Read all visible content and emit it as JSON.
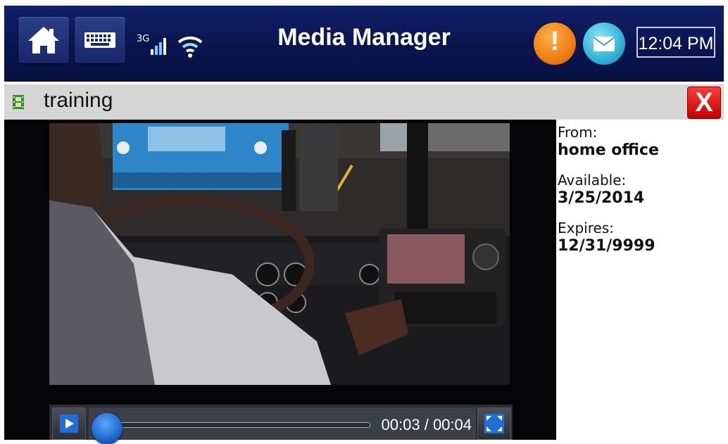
{
  "header": {
    "title": "Media Manager",
    "network_label": "3G",
    "clock": "12:04 PM",
    "alert_symbol": "!",
    "home_icon": "home-icon",
    "keyboard_icon": "keyboard-icon",
    "wifi_icon": "wifi-icon",
    "mail_icon": "mail-icon"
  },
  "subheader": {
    "title": "training",
    "close_label": "X"
  },
  "details": {
    "from_label": "From:",
    "from_value": "home office",
    "available_label": "Available:",
    "available_value": "3/25/2014",
    "expires_label": "Expires:",
    "expires_value": "12/31/9999"
  },
  "player": {
    "time": "00:03 / 00:04",
    "progress": 0.0,
    "play_icon": "play-icon",
    "fullscreen_icon": "fullscreen-icon"
  },
  "colors": {
    "header_bg": "#0a1550",
    "alert": "#ee7d12",
    "mail": "#2fb4d6",
    "close": "#d40000",
    "knob": "#1861c8"
  }
}
